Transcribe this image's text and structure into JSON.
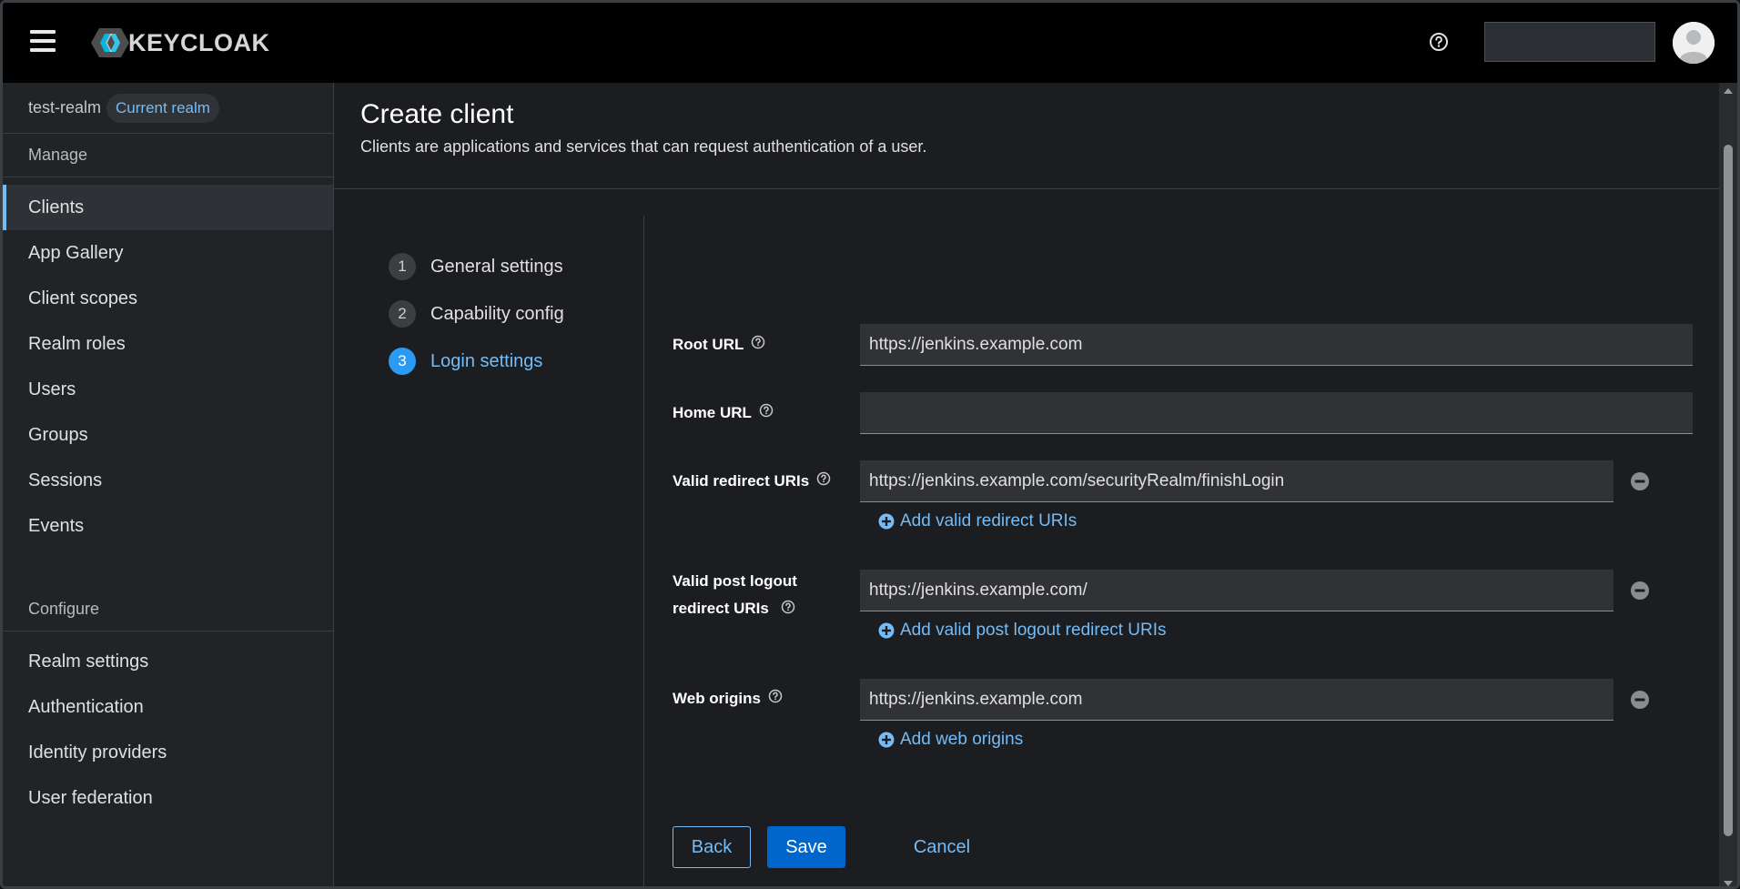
{
  "header": {
    "brand": "KEYCLOAK",
    "menu_icon": "hamburger-menu-icon",
    "help_icon": "question-circle-icon",
    "user_icon": "user-avatar-icon"
  },
  "sidebar": {
    "realm_name": "test-realm",
    "realm_badge": "Current realm",
    "manage_title": "Manage",
    "manage_items": [
      "Clients",
      "App Gallery",
      "Client scopes",
      "Realm roles",
      "Users",
      "Groups",
      "Sessions",
      "Events"
    ],
    "configure_title": "Configure",
    "configure_items": [
      "Realm settings",
      "Authentication",
      "Identity providers",
      "User federation"
    ],
    "active_item": "Clients"
  },
  "page": {
    "title": "Create client",
    "description": "Clients are applications and services that can request authentication of a user."
  },
  "wizard": {
    "steps": [
      {
        "num": "1",
        "label": "General settings"
      },
      {
        "num": "2",
        "label": "Capability config"
      },
      {
        "num": "3",
        "label": "Login settings"
      }
    ],
    "current_step": 3
  },
  "form": {
    "root_url": {
      "label": "Root URL",
      "value": "https://jenkins.example.com"
    },
    "home_url": {
      "label": "Home URL",
      "value": ""
    },
    "valid_redirect": {
      "label": "Valid redirect URIs",
      "value": "https://jenkins.example.com/securityRealm/finishLogin",
      "add_label": "Add valid redirect URIs"
    },
    "post_logout": {
      "label_line1": "Valid post logout",
      "label_line2": "redirect URIs",
      "value": "https://jenkins.example.com/",
      "add_label": "Add valid post logout redirect URIs"
    },
    "web_origins": {
      "label": "Web origins",
      "value": "https://jenkins.example.com",
      "add_label": "Add web origins"
    }
  },
  "actions": {
    "back": "Back",
    "save": "Save",
    "cancel": "Cancel"
  },
  "colors": {
    "accent": "#73bcf7",
    "primary_button": "#0066cc",
    "step_current": "#2b9af3"
  }
}
